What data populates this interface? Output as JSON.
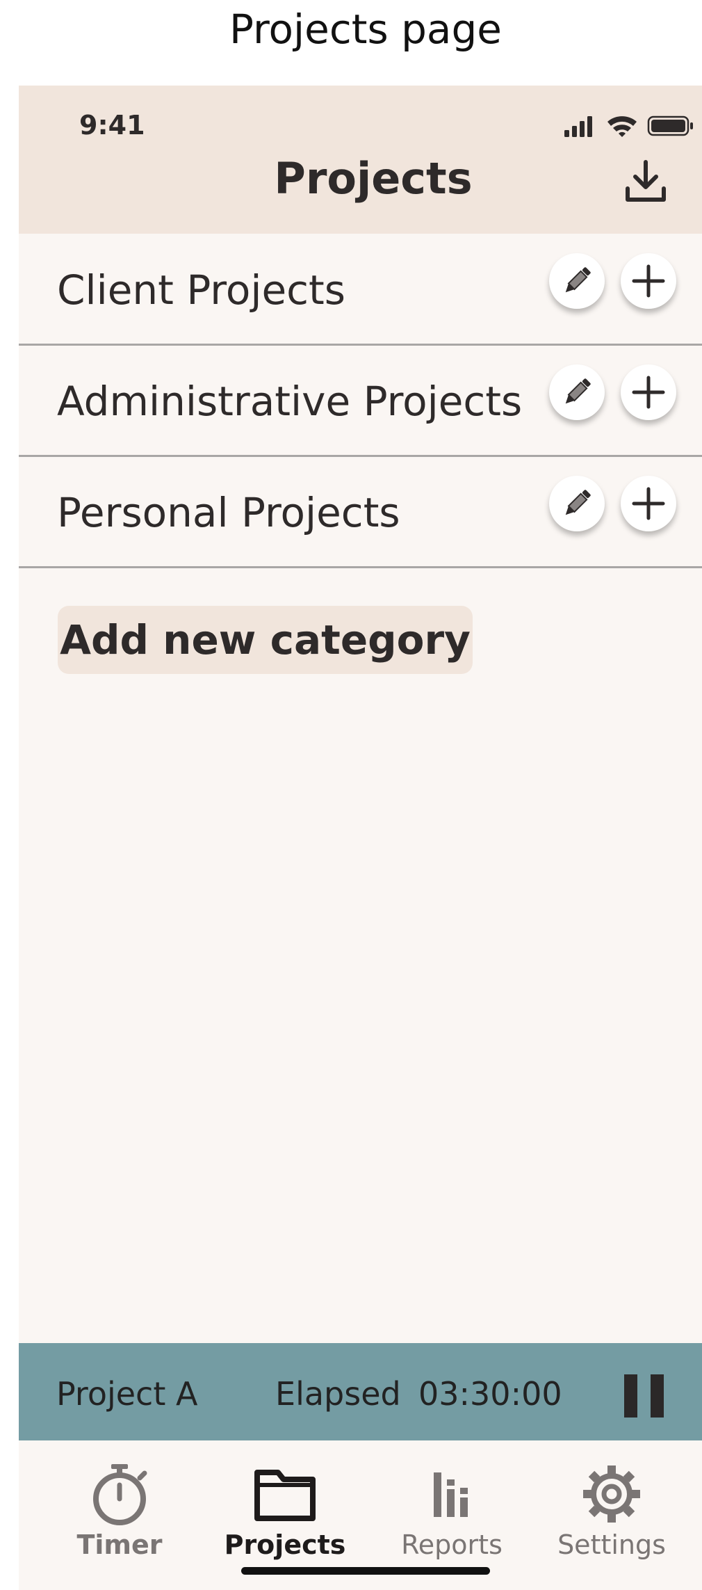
{
  "caption": "Projects page",
  "status_bar": {
    "time": "9:41"
  },
  "header": {
    "title": "Projects",
    "action_icon": "download-icon"
  },
  "categories": [
    {
      "label": "Client Projects"
    },
    {
      "label": "Administrative Projects"
    },
    {
      "label": "Personal Projects"
    }
  ],
  "add_category_label": "Add new category",
  "timer_bar": {
    "project": "Project A",
    "elapsed_label": "Elapsed",
    "elapsed_time": "03:30:00",
    "control_icon": "pause-icon"
  },
  "tabs": [
    {
      "label": "Timer",
      "icon": "stopwatch-icon"
    },
    {
      "label": "Projects",
      "icon": "folder-icon",
      "active": true
    },
    {
      "label": "Reports",
      "icon": "bar-chart-icon"
    },
    {
      "label": "Settings",
      "icon": "gear-icon"
    }
  ],
  "colors": {
    "header_bg": "#f1e5dc",
    "page_bg": "#faf6f3",
    "timer_bar_bg": "#749ca3",
    "text": "#2e2a2a",
    "inactive_tab": "#7a7574"
  }
}
